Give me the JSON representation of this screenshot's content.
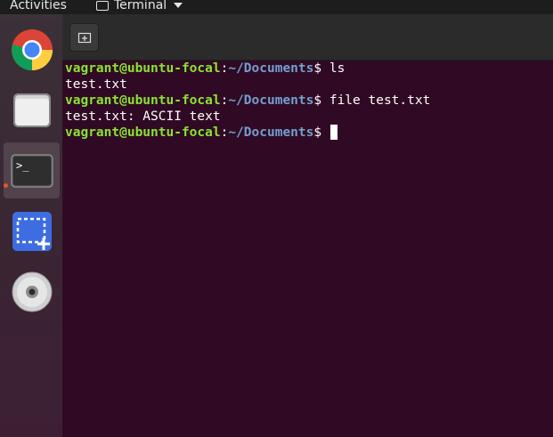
{
  "topbar": {
    "activities_label": "Activities",
    "app_menu_label": "Terminal",
    "app_icon": "terminal-icon"
  },
  "dock": {
    "items": [
      {
        "name": "chrome",
        "icon": "chrome-icon"
      },
      {
        "name": "files",
        "icon": "files-icon"
      },
      {
        "name": "terminal",
        "icon": "terminal-icon",
        "active": true,
        "running": true
      },
      {
        "name": "screenshot",
        "icon": "screenshot-icon"
      },
      {
        "name": "dvd",
        "icon": "disc-icon"
      }
    ],
    "terminal_glyph": ">_"
  },
  "headerbar": {
    "new_tab_icon": "new-tab-icon"
  },
  "terminal": {
    "colors": {
      "background": "#300a24",
      "user": "#8ae234",
      "path": "#729fcf",
      "text": "#ffffff"
    },
    "lines": [
      {
        "type": "prompt",
        "user": "vagrant@ubuntu-focal",
        "sep": ":",
        "path": "~/Documents",
        "dollar": "$ ",
        "command": "ls"
      },
      {
        "type": "output",
        "text": "test.txt"
      },
      {
        "type": "prompt",
        "user": "vagrant@ubuntu-focal",
        "sep": ":",
        "path": "~/Documents",
        "dollar": "$ ",
        "command": "file test.txt"
      },
      {
        "type": "output",
        "text": "test.txt: ASCII text"
      },
      {
        "type": "prompt",
        "user": "vagrant@ubuntu-focal",
        "sep": ":",
        "path": "~/Documents",
        "dollar": "$ ",
        "command": ""
      }
    ]
  }
}
